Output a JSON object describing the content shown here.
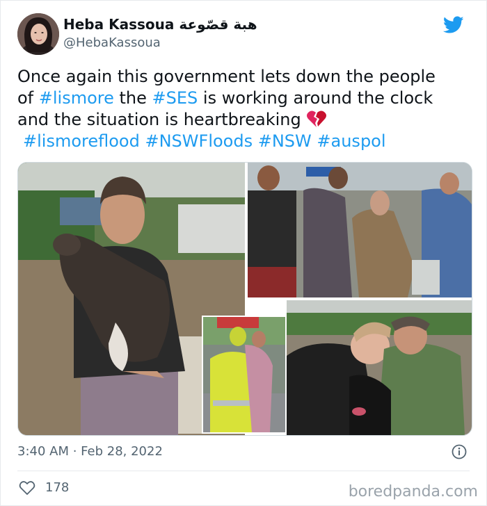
{
  "author": {
    "display_name": "Heba Kassoua هبة قصّوعة",
    "handle": "@HebaKassoua"
  },
  "tweet": {
    "line1_text": "Once again this government lets down the people",
    "line2_prefix": "of ",
    "tag_lismore": "#lismore",
    "line2_mid": " the ",
    "tag_ses": "#SES",
    "line2_suffix": " is working around the clock",
    "line3_text": "and the situation is heartbreaking ",
    "tags_line": [
      "#lismoreflood",
      "#NSWFloods",
      "#NSW",
      "#auspol"
    ]
  },
  "meta": {
    "timestamp": "3:40 AM · Feb 28, 2022"
  },
  "engagement": {
    "like_count": "178"
  },
  "watermark": "boredpanda.com",
  "colors": {
    "link": "#1d9bf0",
    "twitter_blue": "#1d9bf0",
    "secondary_text": "#536471",
    "heart_broken": "#e0245e"
  },
  "icons": [
    "twitter-bird-icon",
    "broken-heart-icon",
    "info-icon",
    "like-heart-icon"
  ]
}
